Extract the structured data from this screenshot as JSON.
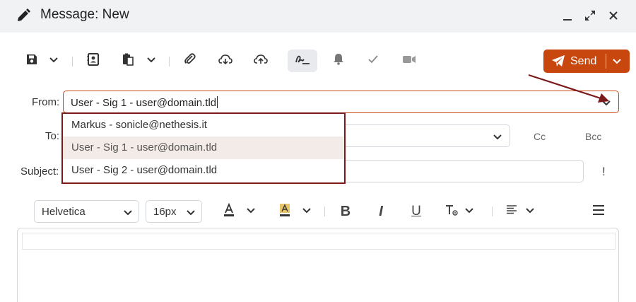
{
  "window": {
    "title": "Message: New"
  },
  "toolbar": {
    "send_label": "Send"
  },
  "form": {
    "from_label": "From:",
    "from_value": "User - Sig 1 - user@domain.tld",
    "to_label": "To:",
    "to_value": "",
    "cc_label": "Cc",
    "bcc_label": "Bcc",
    "subject_label": "Subject:",
    "subject_value": "",
    "priority_label": "!"
  },
  "from_dropdown": {
    "options": [
      "Markus - sonicle@nethesis.it",
      "User - Sig 1 - user@domain.tld",
      "User - Sig 2 - user@domain.tld"
    ],
    "selected_index": 1
  },
  "format": {
    "font_family": "Helvetica",
    "font_size": "16px",
    "bold": "B",
    "italic": "I",
    "underline": "U"
  },
  "colors": {
    "accent": "#c8470f",
    "annotation": "#7a1a1a",
    "titlebar_bg": "#f1f2f4"
  }
}
